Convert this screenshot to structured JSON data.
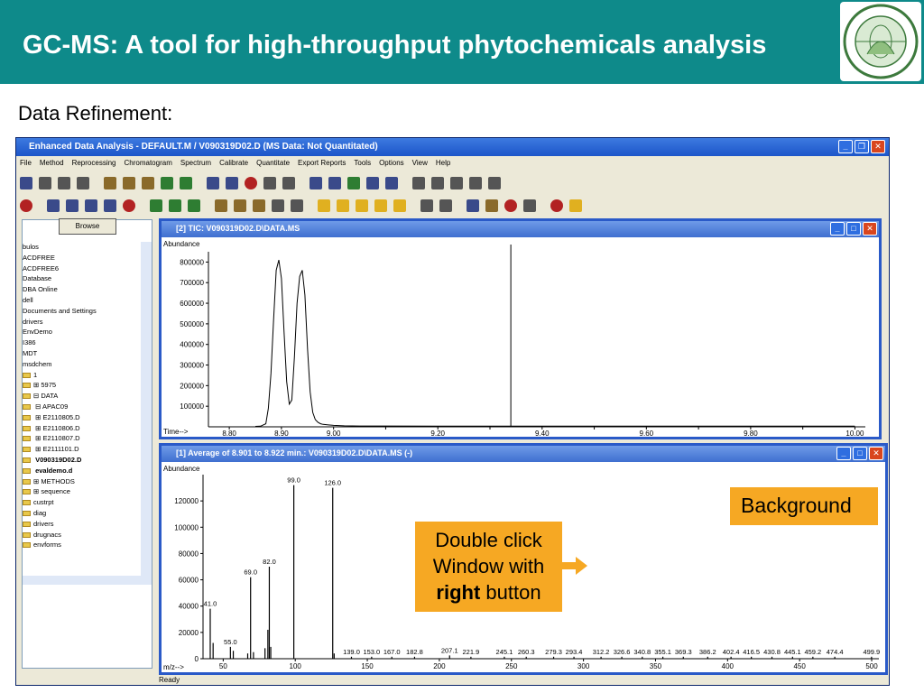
{
  "slide": {
    "title": "GC-MS: A tool for high-throughput phytochemicals analysis",
    "subtitle": "Data Refinement:",
    "logo_icon": "institution-seal-icon",
    "colors": {
      "header": "#0e8a8a",
      "callout": "#f6a823",
      "window_blue": "#2a5ac8"
    }
  },
  "app": {
    "title": "Enhanced Data Analysis - DEFAULT.M / V090319D02.D    (MS Data: Not Quantitated)",
    "menu": [
      "File",
      "Method",
      "Reprocessing",
      "Chromatogram",
      "Spectrum",
      "Calibrate",
      "Quantitate",
      "Export Reports",
      "Tools",
      "Options",
      "View",
      "Help"
    ],
    "browse_label": "Browse",
    "files": [
      {
        "name": "bulos",
        "bold": false
      },
      {
        "name": "",
        "bold": false
      },
      {
        "name": "ACDFREE",
        "bold": false
      },
      {
        "name": "ACDFREE6",
        "bold": false
      },
      {
        "name": "Database",
        "bold": false
      },
      {
        "name": "DBA Online",
        "bold": false
      },
      {
        "name": "dell",
        "bold": false
      },
      {
        "name": "Documents and Settings",
        "bold": false
      },
      {
        "name": "drivers",
        "bold": false
      },
      {
        "name": "EnvDemo",
        "bold": false
      },
      {
        "name": "I386",
        "bold": false
      },
      {
        "name": "MDT",
        "bold": false
      },
      {
        "name": "msdchem",
        "bold": false
      },
      {
        "name": "1",
        "bold": false
      },
      {
        "name": "⊞ 5975",
        "bold": false
      },
      {
        "name": "⊟ DATA",
        "bold": false
      },
      {
        "name": "   ⊟ APAC09",
        "bold": false
      },
      {
        "name": "      ⊞ E2110805.D",
        "bold": false
      },
      {
        "name": "      ⊞ E2110806.D",
        "bold": false
      },
      {
        "name": "      ⊞ E2110807.D",
        "bold": false
      },
      {
        "name": "      ⊞ E2111101.D",
        "bold": false
      },
      {
        "name": "        V090319D02.D",
        "bold": true
      },
      {
        "name": "   evaldemo.d",
        "bold": true
      },
      {
        "name": "⊞ METHODS",
        "bold": false
      },
      {
        "name": "⊞ sequence",
        "bold": false
      },
      {
        "name": "custrpt",
        "bold": false
      },
      {
        "name": "diag",
        "bold": false
      },
      {
        "name": "drivers",
        "bold": false
      },
      {
        "name": "drugnacs",
        "bold": false
      },
      {
        "name": "envforms",
        "bold": false
      }
    ],
    "status": "Ready"
  },
  "tic_window": {
    "title": "[2] TIC: V090319D02.D\\DATA.MS",
    "ylabel": "Abundance",
    "xlabel": "Time-->"
  },
  "ms_window": {
    "title": "[1] Average of 8.901 to 8.922 min.: V090319D02.D\\DATA.MS (-)",
    "ylabel": "Abundance",
    "xlabel": "m/z-->"
  },
  "callouts": {
    "background": "Background",
    "double_click_line1": "Double click",
    "double_click_line2": "Window with",
    "double_click_bold": "right",
    "double_click_rest": " button"
  },
  "chart_data": [
    {
      "type": "line",
      "title": "TIC: V090319D02.D\\DATA.MS",
      "xlabel": "Time-->",
      "ylabel": "Abundance",
      "xlim": [
        8.76,
        10.02
      ],
      "ylim": [
        0,
        850000
      ],
      "xticks": [
        8.8,
        8.9,
        9.0,
        9.1,
        9.2,
        9.3,
        9.4,
        9.5,
        9.6,
        9.7,
        9.8,
        9.9,
        10.0
      ],
      "xtick_labels": [
        "8.80",
        "",
        "8.90",
        "",
        "9.00",
        "",
        "9.20",
        "",
        "9.40",
        "",
        "9.60",
        "",
        "9.80",
        "",
        "10.00"
      ],
      "yticks": [
        100000,
        200000,
        300000,
        400000,
        500000,
        600000,
        700000,
        800000
      ],
      "x": [
        8.85,
        8.86,
        8.87,
        8.875,
        8.88,
        8.885,
        8.89,
        8.895,
        8.9,
        8.905,
        8.91,
        8.915,
        8.92,
        8.925,
        8.93,
        8.935,
        8.94,
        8.945,
        8.95,
        8.955,
        8.96,
        8.965,
        8.97,
        8.975,
        8.98,
        8.99,
        9.0,
        9.02,
        9.05,
        9.1,
        9.2,
        9.4,
        9.6,
        9.8,
        10.0
      ],
      "y": [
        2000,
        3000,
        15000,
        90000,
        260000,
        520000,
        760000,
        810000,
        720000,
        460000,
        220000,
        110000,
        130000,
        340000,
        600000,
        730000,
        760000,
        640000,
        380000,
        170000,
        70000,
        35000,
        22000,
        15000,
        12000,
        9000,
        7000,
        5000,
        4000,
        4000,
        3000,
        3000,
        3000,
        3000,
        3000
      ],
      "cursor_x": 9.34
    },
    {
      "type": "bar",
      "title": "Average of 8.901 to 8.922 min.: V090319D02.D\\DATA.MS (-)",
      "xlabel": "m/z-->",
      "ylabel": "Abundance",
      "xlim": [
        36,
        505
      ],
      "ylim": [
        0,
        140000
      ],
      "xticks": [
        50,
        100,
        150,
        200,
        250,
        300,
        350,
        400,
        450,
        500
      ],
      "yticks": [
        0,
        20000,
        40000,
        60000,
        80000,
        100000,
        120000
      ],
      "peaks": [
        {
          "mz": 41.0,
          "value": 38000,
          "label": "41.0"
        },
        {
          "mz": 43.0,
          "value": 12000,
          "label": ""
        },
        {
          "mz": 55.0,
          "value": 9000,
          "label": "55.0"
        },
        {
          "mz": 57.0,
          "value": 6000,
          "label": ""
        },
        {
          "mz": 67.0,
          "value": 4000,
          "label": ""
        },
        {
          "mz": 69.0,
          "value": 62000,
          "label": "69.0"
        },
        {
          "mz": 71.0,
          "value": 5000,
          "label": ""
        },
        {
          "mz": 79.0,
          "value": 8000,
          "label": ""
        },
        {
          "mz": 81.0,
          "value": 22000,
          "label": ""
        },
        {
          "mz": 82.0,
          "value": 70000,
          "label": "82.0"
        },
        {
          "mz": 83.0,
          "value": 9000,
          "label": ""
        },
        {
          "mz": 99.0,
          "value": 132000,
          "label": "99.0"
        },
        {
          "mz": 126.0,
          "value": 130000,
          "label": "126.0"
        },
        {
          "mz": 127.0,
          "value": 4000,
          "label": ""
        },
        {
          "mz": 139.0,
          "value": 1500,
          "label": "139.0"
        },
        {
          "mz": 153.0,
          "value": 1500,
          "label": "153.0"
        },
        {
          "mz": 167.0,
          "value": 1500,
          "label": "167.0"
        },
        {
          "mz": 182.8,
          "value": 1500,
          "label": "182.8"
        },
        {
          "mz": 207.1,
          "value": 2500,
          "label": "207.1"
        },
        {
          "mz": 221.9,
          "value": 1500,
          "label": "221.9"
        },
        {
          "mz": 245.1,
          "value": 1500,
          "label": "245.1"
        },
        {
          "mz": 260.3,
          "value": 1500,
          "label": "260.3"
        },
        {
          "mz": 279.3,
          "value": 1500,
          "label": "279.3"
        },
        {
          "mz": 293.4,
          "value": 1500,
          "label": "293.4"
        },
        {
          "mz": 312.2,
          "value": 1500,
          "label": "312.2"
        },
        {
          "mz": 326.6,
          "value": 1500,
          "label": "326.6"
        },
        {
          "mz": 340.8,
          "value": 1500,
          "label": "340.8"
        },
        {
          "mz": 355.1,
          "value": 1500,
          "label": "355.1"
        },
        {
          "mz": 369.3,
          "value": 1500,
          "label": "369.3"
        },
        {
          "mz": 386.2,
          "value": 1500,
          "label": "386.2"
        },
        {
          "mz": 402.4,
          "value": 1500,
          "label": "402.4"
        },
        {
          "mz": 416.5,
          "value": 1500,
          "label": "416.5"
        },
        {
          "mz": 430.8,
          "value": 1500,
          "label": "430.8"
        },
        {
          "mz": 445.1,
          "value": 1500,
          "label": "445.1"
        },
        {
          "mz": 459.2,
          "value": 1500,
          "label": "459.2"
        },
        {
          "mz": 474.4,
          "value": 1500,
          "label": "474.4"
        },
        {
          "mz": 499.9,
          "value": 1500,
          "label": "499.9"
        }
      ]
    }
  ]
}
